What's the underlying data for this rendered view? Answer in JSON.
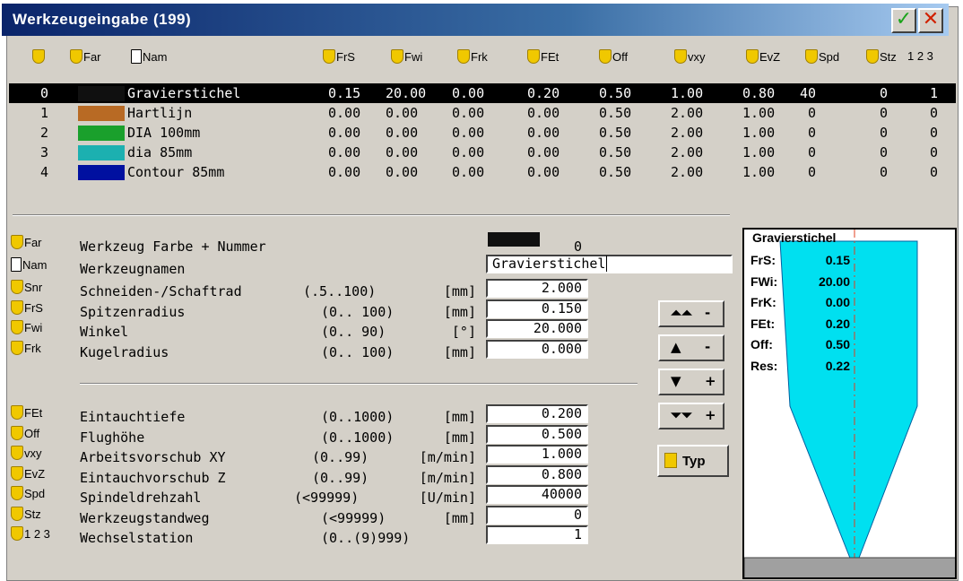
{
  "window": {
    "title": "Werkzeugeingabe (199)",
    "ok_icon": "check-icon",
    "cancel_icon": "x-icon"
  },
  "table": {
    "headers": [
      "Far",
      "Nam",
      "FrS",
      "Fwi",
      "Frk",
      "FEt",
      "Off",
      "vxy",
      "EvZ",
      "Spd",
      "Stz",
      "1 2 3"
    ],
    "rows": [
      {
        "nr": "0",
        "color": "#101010",
        "name": "Gravierstichel",
        "frs": "0.15",
        "fwi": "20.00",
        "frk": "0.00",
        "fet": "0.20",
        "off": "0.50",
        "vxy": "1.00",
        "evz": "0.80",
        "spd": "40",
        "stz": "0",
        "ws": "1"
      },
      {
        "nr": "1",
        "color": "#b86a24",
        "name": "Hartlijn",
        "frs": "0.00",
        "fwi": "0.00",
        "frk": "0.00",
        "fet": "0.00",
        "off": "0.50",
        "vxy": "2.00",
        "evz": "1.00",
        "spd": "0",
        "stz": "0",
        "ws": "0"
      },
      {
        "nr": "2",
        "color": "#1aa02c",
        "name": "DIA 100mm",
        "frs": "0.00",
        "fwi": "0.00",
        "frk": "0.00",
        "fet": "0.00",
        "off": "0.50",
        "vxy": "2.00",
        "evz": "1.00",
        "spd": "0",
        "stz": "0",
        "ws": "0"
      },
      {
        "nr": "3",
        "color": "#1cb0b0",
        "name": "dia 85mm",
        "frs": "0.00",
        "fwi": "0.00",
        "frk": "0.00",
        "fet": "0.00",
        "off": "0.50",
        "vxy": "2.00",
        "evz": "1.00",
        "spd": "0",
        "stz": "0",
        "ws": "0"
      },
      {
        "nr": "4",
        "color": "#0010a0",
        "name": "Contour 85mm",
        "frs": "0.00",
        "fwi": "0.00",
        "frk": "0.00",
        "fet": "0.00",
        "off": "0.50",
        "vxy": "2.00",
        "evz": "1.00",
        "spd": "0",
        "stz": "0",
        "ws": "0"
      }
    ]
  },
  "form": {
    "color_number": {
      "icon": "Far",
      "label": "Werkzeug Farbe + Nummer",
      "swatch": "#101010",
      "value": "0"
    },
    "name": {
      "icon": "Nam",
      "label": "Werkzeugnamen",
      "value": "Gravierstichel"
    },
    "fields_a": [
      {
        "icon": "Snr",
        "label": "Schneiden-/Schaftrad",
        "range": "(.5..100)",
        "unit": "[mm]",
        "value": "2.000"
      },
      {
        "icon": "FrS",
        "label": "Spitzenradius",
        "range": "(0.. 100)",
        "unit": "[mm]",
        "value": "0.150"
      },
      {
        "icon": "Fwi",
        "label": "Winkel",
        "range": "(0.. 90)",
        "unit": "[°]",
        "value": "20.000"
      },
      {
        "icon": "Frk",
        "label": "Kugelradius",
        "range": "(0.. 100)",
        "unit": "[mm]",
        "value": "0.000"
      }
    ],
    "fields_b": [
      {
        "icon": "FEt",
        "label": "Eintauchtiefe",
        "range": "(0..1000)",
        "unit": "[mm]",
        "value": "0.200"
      },
      {
        "icon": "Off",
        "label": "Flughöhe",
        "range": "(0..1000)",
        "unit": "[mm]",
        "value": "0.500"
      },
      {
        "icon": "vxy",
        "label": "Arbeitsvorschub XY",
        "range": "(0..99)",
        "unit": "[m/min]",
        "value": "1.000"
      },
      {
        "icon": "EvZ",
        "label": "Eintauchvorschub Z",
        "range": "(0..99)",
        "unit": "[m/min]",
        "value": "0.800"
      },
      {
        "icon": "Spd",
        "label": "Spindeldrehzahl",
        "range": "(<99999)",
        "unit": "[U/min]",
        "value": "40000"
      },
      {
        "icon": "Stz",
        "label": "Werkzeugstandweg",
        "range": "(<99999)",
        "unit": "[mm]",
        "value": "0"
      },
      {
        "icon": "1 2 3",
        "label": "Wechselstation",
        "range": "(0..(9)999)",
        "unit": "",
        "value": "1"
      }
    ]
  },
  "nav": [
    {
      "arrow": "⏶⏶",
      "sign": "-"
    },
    {
      "arrow": "▲",
      "sign": "-"
    },
    {
      "arrow": "▼",
      "sign": "+"
    },
    {
      "arrow": "⏷⏷",
      "sign": "+"
    }
  ],
  "typ_label": "Typ",
  "preview": {
    "title": "Gravierstichel",
    "params": [
      {
        "k": "FrS:",
        "v": "0.15"
      },
      {
        "k": "FWi:",
        "v": "20.00"
      },
      {
        "k": "FrK:",
        "v": "0.00"
      },
      {
        "k": "FEt:",
        "v": "0.20"
      },
      {
        "k": "Off:",
        "v": "0.50"
      },
      {
        "k": "Res:",
        "v": "0.22"
      }
    ],
    "tool_color": "#00e0f0"
  }
}
